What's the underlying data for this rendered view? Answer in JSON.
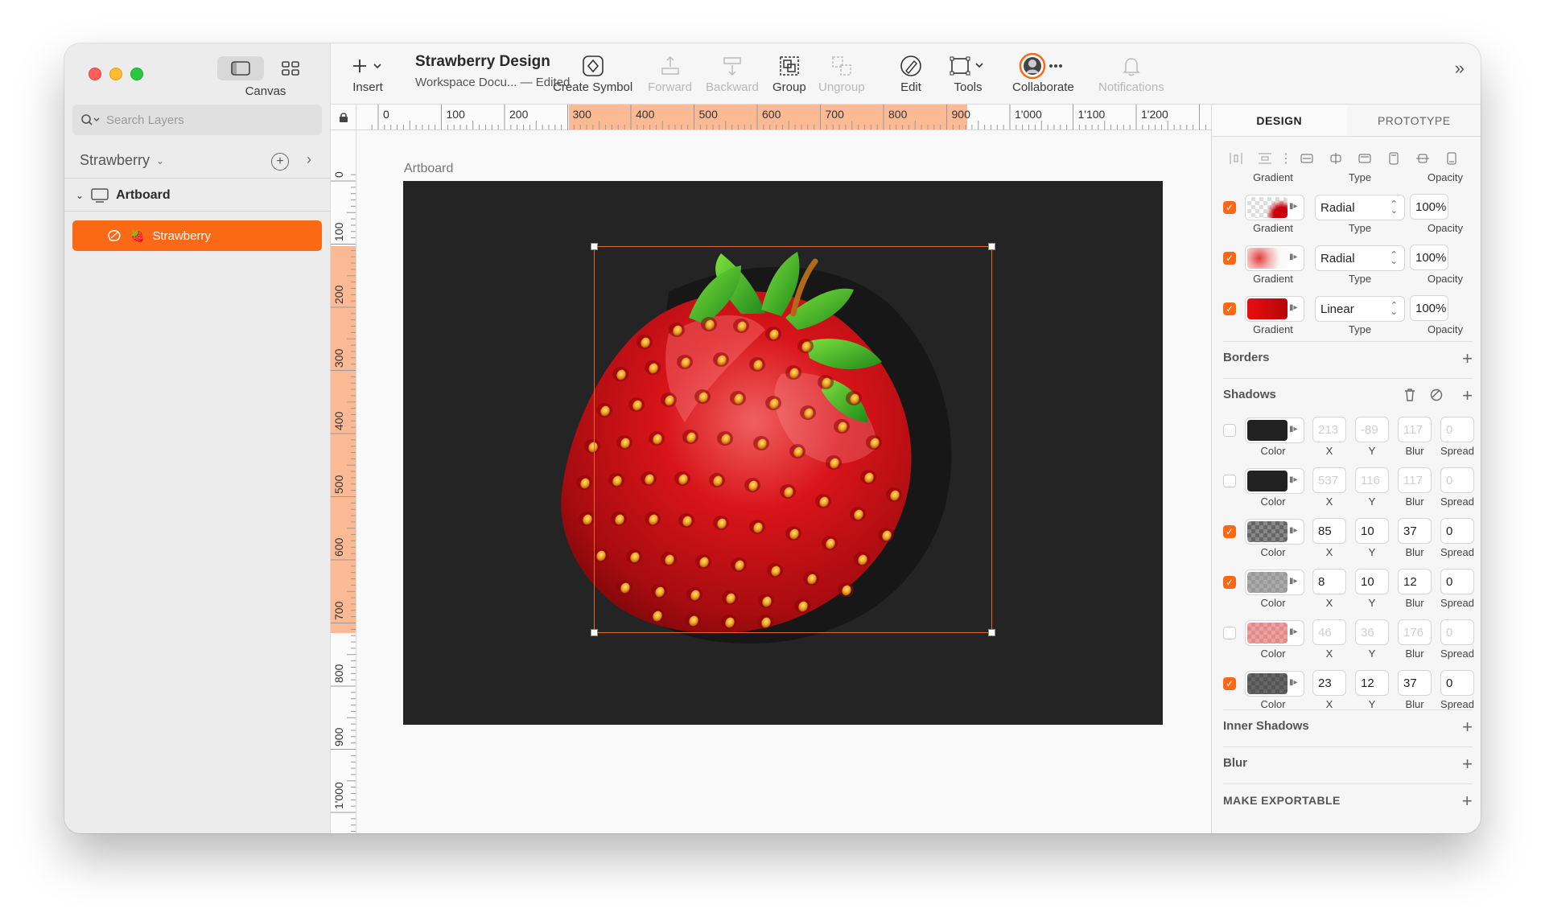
{
  "sidebar": {
    "canvas_label": "Canvas",
    "search_placeholder": "Search Layers",
    "page_name": "Strawberry",
    "artboard_name": "Artboard",
    "layer_name": "Strawberry",
    "layer_emoji": "🍓"
  },
  "toolbar": {
    "insert": "Insert",
    "doc_title": "Strawberry Design",
    "doc_subtitle": "Workspace Docu...  — Edited",
    "create_symbol": "Create Symbol",
    "forward": "Forward",
    "backward": "Backward",
    "group": "Group",
    "ungroup": "Ungroup",
    "edit": "Edit",
    "tools": "Tools",
    "collaborate": "Collaborate",
    "notifications": "Notifications"
  },
  "ruler": {
    "top": [
      "0",
      "100",
      "200",
      "300",
      "400",
      "500",
      "600",
      "700",
      "800",
      "900",
      "1'000",
      "1'100",
      "1'200"
    ],
    "left": [
      "0",
      "100",
      "200",
      "300",
      "400",
      "500",
      "600",
      "700",
      "800",
      "900",
      "1'000"
    ]
  },
  "canvas": {
    "artboard_label": "Artboard",
    "accent_color": "#fa6a16"
  },
  "inspector": {
    "tabs": [
      "DESIGN",
      "PROTOTYPE"
    ],
    "fill_captions": {
      "gradient": "Gradient",
      "type": "Type",
      "opacity": "Opacity"
    },
    "fills": [
      {
        "type": "Radial",
        "opacity": "100%"
      },
      {
        "type": "Radial",
        "opacity": "100%"
      },
      {
        "type": "Linear",
        "opacity": "100%"
      }
    ],
    "borders_title": "Borders",
    "shadows_title": "Shadows",
    "shadow_captions": {
      "color": "Color",
      "x": "X",
      "y": "Y",
      "blur": "Blur",
      "spread": "Spread"
    },
    "shadows": [
      {
        "enabled": false,
        "x": "213",
        "y": "-89",
        "blur": "117",
        "spread": "0"
      },
      {
        "enabled": false,
        "x": "537",
        "y": "116",
        "blur": "117",
        "spread": "0"
      },
      {
        "enabled": true,
        "x": "85",
        "y": "10",
        "blur": "37",
        "spread": "0"
      },
      {
        "enabled": true,
        "x": "8",
        "y": "10",
        "blur": "12",
        "spread": "0"
      },
      {
        "enabled": false,
        "x": "46",
        "y": "36",
        "blur": "176",
        "spread": "0"
      },
      {
        "enabled": true,
        "x": "23",
        "y": "12",
        "blur": "37",
        "spread": "0"
      }
    ],
    "inner_shadows_title": "Inner Shadows",
    "blur_title": "Blur",
    "exportable_title": "MAKE EXPORTABLE"
  }
}
